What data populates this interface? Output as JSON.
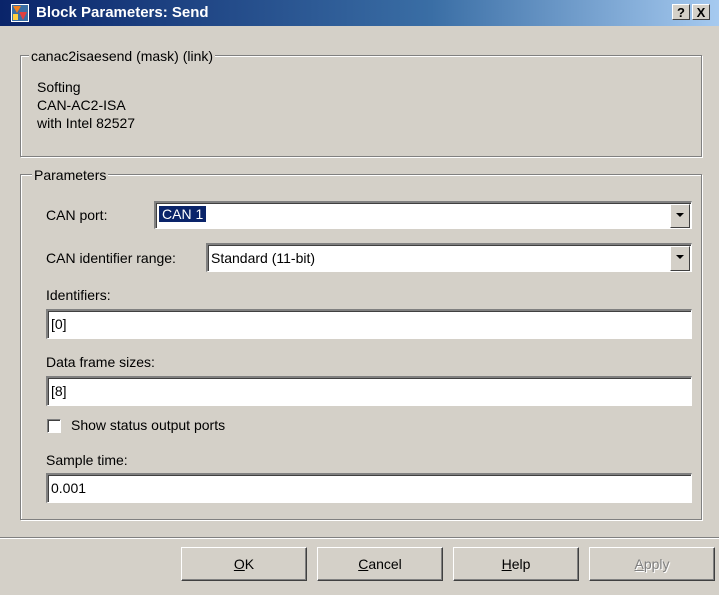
{
  "window": {
    "title": "Block Parameters: Send",
    "help_label": "?",
    "close_label": "X"
  },
  "mask_group": {
    "legend": "canac2isaesend (mask) (link)",
    "description_lines": [
      "Softing",
      "CAN-AC2-ISA",
      "with Intel 82527"
    ]
  },
  "params_group": {
    "legend": "Parameters",
    "can_port": {
      "label": "CAN port:",
      "value": "CAN 1"
    },
    "id_range": {
      "label": "CAN identifier range:",
      "value": "Standard (11-bit)"
    },
    "identifiers": {
      "label": "Identifiers:",
      "value": "[0]"
    },
    "frame_sizes": {
      "label": "Data frame sizes:",
      "value": "[8]"
    },
    "status_ports": {
      "label": "Show status output ports",
      "checked": false
    },
    "sample_time": {
      "label": "Sample time:",
      "value": "0.001"
    }
  },
  "buttons": {
    "ok": {
      "hotkey": "O",
      "rest": "K"
    },
    "cancel": {
      "hotkey": "C",
      "rest": "ancel"
    },
    "help": {
      "hotkey": "H",
      "rest": "elp"
    },
    "apply": {
      "hotkey": "A",
      "rest": "pply",
      "enabled": false
    }
  },
  "colors": {
    "titlebar_start": "#0a246a",
    "titlebar_end": "#a6caf0",
    "face": "#d4d0c8",
    "selection": "#0a246a"
  },
  "icons": {
    "app": "simulink-block-icon",
    "dropdown": "chevron-down-icon"
  }
}
